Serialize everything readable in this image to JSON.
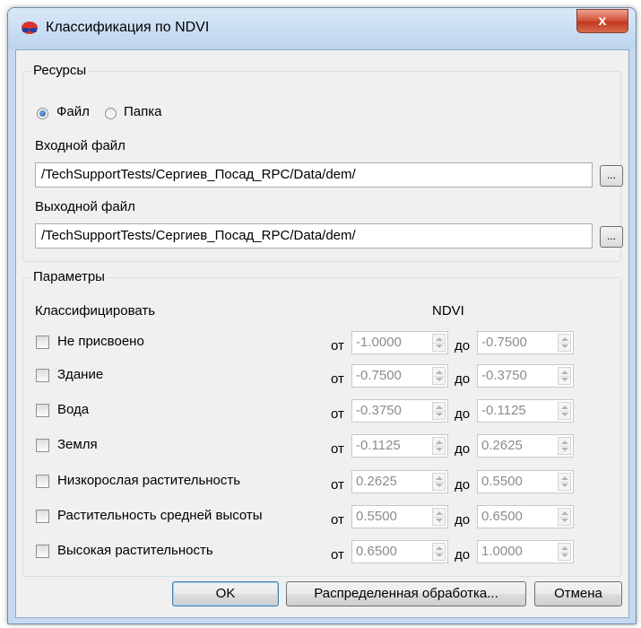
{
  "window": {
    "title": "Классификация по NDVI",
    "close_label": "x"
  },
  "resources": {
    "legend": "Ресурсы",
    "mode_options": [
      {
        "label": "Файл",
        "checked": true
      },
      {
        "label": "Папка",
        "checked": false
      }
    ],
    "input_label": "Входной файл",
    "input_value": "/TechSupportTests/Сергиев_Посад_RPC/Data/dem/",
    "output_label": "Выходной файл",
    "output_value": "/TechSupportTests/Сергиев_Посад_RPC/Data/dem/",
    "browse_label": "..."
  },
  "params": {
    "legend": "Параметры",
    "classify_header": "Классифицировать",
    "ndvi_header": "NDVI",
    "from_label": "от",
    "to_label": "до",
    "classes": [
      {
        "name": "Не присвоено",
        "checked": false,
        "from": "-1.0000",
        "to": "-0.7500"
      },
      {
        "name": "Здание",
        "checked": false,
        "from": "-0.7500",
        "to": "-0.3750"
      },
      {
        "name": "Вода",
        "checked": false,
        "from": "-0.3750",
        "to": "-0.1125"
      },
      {
        "name": "Земля",
        "checked": false,
        "from": "-0.1125",
        "to": "0.2625"
      },
      {
        "name": "Низкорослая растительность",
        "checked": false,
        "from": "0.2625",
        "to": "0.5500"
      },
      {
        "name": "Растительность средней высоты",
        "checked": false,
        "from": "0.5500",
        "to": "0.6500"
      },
      {
        "name": "Высокая растительность",
        "checked": false,
        "from": "0.6500",
        "to": "1.0000"
      }
    ]
  },
  "buttons": {
    "ok": "OK",
    "distributed": "Распределенная обработка...",
    "cancel": "Отмена"
  }
}
